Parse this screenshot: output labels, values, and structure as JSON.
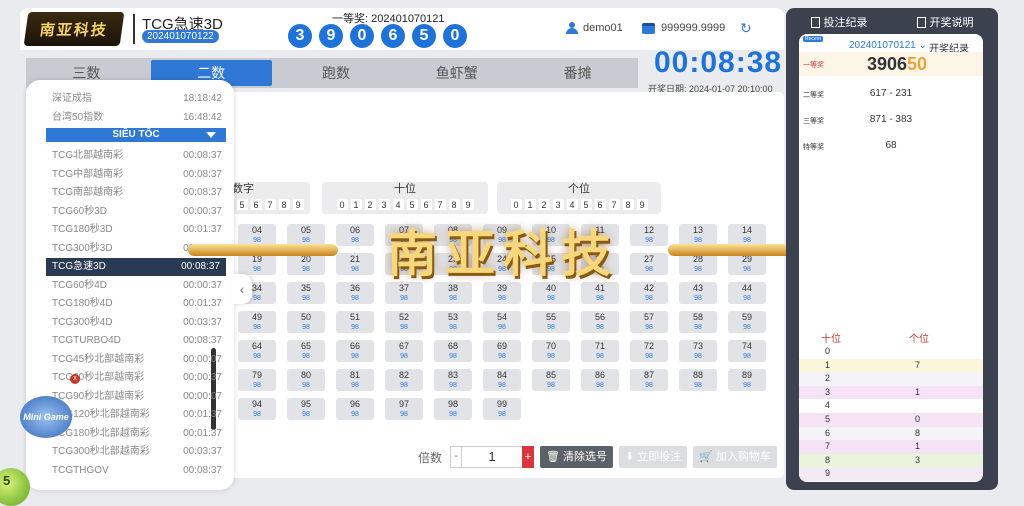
{
  "header": {
    "logo_text": "南亚科技",
    "game_name": "TCG急速3D",
    "issue": "202401070122",
    "first_prize_label": "一等奖: 202401070121",
    "balls": [
      "3",
      "9",
      "0",
      "6",
      "5",
      "0"
    ],
    "user": "demo01",
    "balance": "999999.9999",
    "timer": "00:08:38",
    "draw_date": "开奖日期: 2024-01-07 20:10:00"
  },
  "tabs": [
    "三数",
    "二数",
    "跑数",
    "鱼虾蟹",
    "番摊"
  ],
  "game_list": {
    "top_items": [
      {
        "name": "深证成指",
        "time": "18:18:42"
      },
      {
        "name": "台湾50指数",
        "time": "16:48:42"
      }
    ],
    "section": "SIÊU TỐC",
    "items": [
      {
        "name": "TCG北部越南彩",
        "time": "00:08:37"
      },
      {
        "name": "TCG中部越南彩",
        "time": "00:08:37"
      },
      {
        "name": "TCG南部越南彩",
        "time": "00:08:37"
      },
      {
        "name": "TCG60秒3D",
        "time": "00:00:37"
      },
      {
        "name": "TCG180秒3D",
        "time": "00:01:37"
      },
      {
        "name": "TCG300秒3D",
        "time": "00:03:37"
      },
      {
        "name": "TCG急速3D",
        "time": "00:08:37",
        "active": true
      },
      {
        "name": "TCG60秒4D",
        "time": "00:00:37"
      },
      {
        "name": "TCG180秒4D",
        "time": "00:01:37"
      },
      {
        "name": "TCG300秒4D",
        "time": "00:03:37"
      },
      {
        "name": "TCGTURBO4D",
        "time": "00:08:37"
      },
      {
        "name": "TCG45秒北部越南彩",
        "time": "00:00:07"
      },
      {
        "name": "TCG60秒北部越南彩",
        "time": "00:00:37"
      },
      {
        "name": "TCG90秒北部越南彩",
        "time": "00:00:07"
      },
      {
        "name": "TCG120秒北部越南彩",
        "time": "00:01:37"
      },
      {
        "name": "TCG180秒北部越南彩",
        "time": "00:01:37"
      },
      {
        "name": "TCG300秒北部越南彩",
        "time": "00:03:37"
      },
      {
        "name": "TCGTHGOV",
        "time": "00:08:37"
      }
    ]
  },
  "positions": [
    {
      "title": "数字",
      "digits": [
        "5",
        "6",
        "7",
        "8",
        "9"
      ]
    },
    {
      "title": "十位",
      "digits": [
        "0",
        "1",
        "2",
        "3",
        "4",
        "5",
        "6",
        "7",
        "8",
        "9"
      ]
    },
    {
      "title": "个位",
      "digits": [
        "0",
        "1",
        "2",
        "3",
        "4",
        "5",
        "6",
        "7",
        "8",
        "9"
      ]
    }
  ],
  "odds": "98",
  "number_rows": [
    [
      "04",
      "05",
      "06",
      "07",
      "08",
      "09",
      "10",
      "11",
      "12",
      "13",
      "14"
    ],
    [
      "19",
      "20",
      "21",
      "22",
      "23",
      "24",
      "25",
      "26",
      "27",
      "28",
      "29"
    ],
    [
      "34",
      "35",
      "36",
      "37",
      "38",
      "39",
      "40",
      "41",
      "42",
      "43",
      "44"
    ],
    [
      "49",
      "50",
      "51",
      "52",
      "53",
      "54",
      "55",
      "56",
      "57",
      "58",
      "59"
    ],
    [
      "64",
      "65",
      "66",
      "67",
      "68",
      "69",
      "70",
      "71",
      "72",
      "73",
      "74"
    ],
    [
      "79",
      "80",
      "81",
      "82",
      "83",
      "84",
      "85",
      "86",
      "87",
      "88",
      "89"
    ],
    [
      "94",
      "95",
      "96",
      "97",
      "98",
      "99"
    ]
  ],
  "watermark": "南亚科技",
  "mascot": "Mini Game",
  "green_ball": "5",
  "bottom": {
    "multiplier_label": "倍数",
    "minus": "-",
    "quantity": "1",
    "plus": "+",
    "clear": "清除选号",
    "confirm": "立即投注",
    "cart": "加入购物车"
  },
  "right_panel": {
    "bet_record": "投注纪录",
    "rules": "开奖说明",
    "tag": "Recent",
    "issue": "202401070121",
    "title": "开奖纪录",
    "prizes": [
      {
        "label": "一等奖",
        "value_a": "3906",
        "value_b": "50"
      },
      {
        "label": "二等奖",
        "value": "617 - 231"
      },
      {
        "label": "三等奖",
        "value": "871 - 383"
      },
      {
        "label": "特等奖",
        "value": "68"
      }
    ],
    "col_tens": "十位",
    "col_units": "个位",
    "freq": [
      {
        "d": "0",
        "t": "",
        "u": ""
      },
      {
        "d": "1",
        "t": "",
        "u": "7"
      },
      {
        "d": "2",
        "t": "",
        "u": ""
      },
      {
        "d": "3",
        "t": "",
        "u": "1"
      },
      {
        "d": "4",
        "t": "",
        "u": ""
      },
      {
        "d": "5",
        "t": "",
        "u": "0"
      },
      {
        "d": "6",
        "t": "",
        "u": "8"
      },
      {
        "d": "7",
        "t": "",
        "u": "1"
      },
      {
        "d": "8",
        "t": "",
        "u": "3"
      },
      {
        "d": "9",
        "t": "",
        "u": ""
      }
    ],
    "freq_colors": [
      "#ffffff",
      "#fbf6d9",
      "#f3f3f8",
      "#f5e2f5",
      "#ffffff",
      "#f5e2f5",
      "#f3f3f8",
      "#f5e2f5",
      "#e8f4dc",
      "#f3eaf6"
    ]
  }
}
